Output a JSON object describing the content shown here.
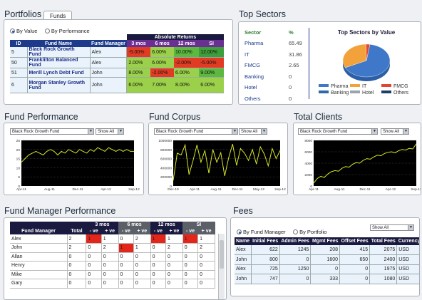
{
  "portfolios": {
    "title": "Portfolios",
    "tab": "Funds",
    "radio_value": "By Value",
    "radio_performance": "By Performance",
    "group_header": "Absolute Returns",
    "headers": [
      "ID",
      "Fund Name",
      "Fund Manager",
      "3 mos",
      "6 mos",
      "12 mos",
      "SI"
    ],
    "rows": [
      {
        "id": "5",
        "name": "Black Rock Growth Fund",
        "manager": "Alex",
        "r3": "-5.00%",
        "r6": "6.00%",
        "r12": "10.00%",
        "si": "12.00%"
      },
      {
        "id": "50",
        "name": "Franklilton Balanced Fund",
        "manager": "Alex",
        "r3": "2.00%",
        "r6": "6.00%",
        "r12": "-2.00%",
        "si": "-5.00%"
      },
      {
        "id": "51",
        "name": "Merill Lynch Debt Fund",
        "manager": "John",
        "r3": "8.00%",
        "r6": "-2.00%",
        "r12": "6.00%",
        "si": "9.00%"
      },
      {
        "id": "6",
        "name": "Morgan Stanley Growth Fund",
        "manager": "John",
        "r3": "6.00%",
        "r6": "7.00%",
        "r12": "8.00%",
        "si": "6.00%"
      }
    ],
    "colors": {
      "r1": [
        "#e23b23",
        "#9bd04a",
        "#5cb83e",
        "#3d9f3a"
      ],
      "r2": [
        "#9bd04a",
        "#9bd04a",
        "#e23b23",
        "#e23b23"
      ],
      "r3": [
        "#9bd04a",
        "#e23b23",
        "#9bd04a",
        "#5cb83e"
      ],
      "r4": [
        "#9bd04a",
        "#9bd04a",
        "#9bd04a",
        "#9bd04a"
      ]
    }
  },
  "sectors": {
    "title": "Top Sectors",
    "col_sector": "Sector",
    "col_pct": "%",
    "rows": [
      {
        "name": "Pharma",
        "value": "65.49"
      },
      {
        "name": "IT",
        "value": "31.86"
      },
      {
        "name": "FMCG",
        "value": "2.65"
      },
      {
        "name": "Banking",
        "value": "0"
      },
      {
        "name": "Hotel",
        "value": "0"
      },
      {
        "name": "Others",
        "value": "0"
      }
    ]
  },
  "fund_performance": {
    "title": "Fund Performance",
    "fund_select": "Black Rock Growth Fund",
    "range_select": "Show All"
  },
  "fund_corpus": {
    "title": "Fund Corpus",
    "fund_select": "Black Rock Growth Fund",
    "range_select": "Show All"
  },
  "total_clients": {
    "title": "Total Clients",
    "fund_select": "Black Rock Growth Fund",
    "range_select": "Show All"
  },
  "fmp": {
    "title": "Fund Manager Performance",
    "groups": [
      "3 mos",
      "6 mos",
      "12 mos",
      "SI"
    ],
    "col_manager": "Fund Manager",
    "col_total": "Total",
    "neg": "- ve",
    "pos": "+ ve",
    "rows": [
      {
        "name": "Alex",
        "vals": [
          "2",
          "1",
          "1",
          "0",
          "2",
          "1",
          "1",
          "1",
          "1"
        ]
      },
      {
        "name": "John",
        "vals": [
          "2",
          "0",
          "2",
          "1",
          "1",
          "0",
          "2",
          "0",
          "2"
        ]
      },
      {
        "name": "Allan",
        "vals": [
          "0",
          "0",
          "0",
          "0",
          "0",
          "0",
          "0",
          "0",
          "0"
        ]
      },
      {
        "name": "Henry",
        "vals": [
          "0",
          "0",
          "0",
          "0",
          "0",
          "0",
          "0",
          "0",
          "0"
        ]
      },
      {
        "name": "Mike",
        "vals": [
          "0",
          "0",
          "0",
          "0",
          "0",
          "0",
          "0",
          "0",
          "0"
        ]
      },
      {
        "name": "Gary",
        "vals": [
          "0",
          "0",
          "0",
          "0",
          "0",
          "0",
          "0",
          "0",
          "0"
        ]
      }
    ]
  },
  "fees": {
    "title": "Fees",
    "radio_manager": "By Fund Manager",
    "radio_portfolio": "By Portfolio",
    "select": "Show All",
    "headers": [
      "Name",
      "Initial Fees",
      "Admin Fees",
      "Mgmt Fees",
      "Offset Fees",
      "Total Fees",
      "Currency"
    ],
    "rows": [
      [
        "Alex",
        "622",
        "1245",
        "208",
        "415",
        "2075",
        "USD"
      ],
      [
        "John",
        "800",
        "0",
        "1600",
        "650",
        "2400",
        "USD"
      ],
      [
        "Alex",
        "725",
        "1250",
        "0",
        "0",
        "1975",
        "USD"
      ],
      [
        "John",
        "747",
        "0",
        "333",
        "0",
        "1080",
        "USD"
      ]
    ]
  },
  "chart_data": [
    {
      "type": "pie",
      "title": "Top Sectors by Value",
      "categories": [
        "Pharma",
        "IT",
        "FMCG",
        "Banking",
        "Hotel",
        "Others"
      ],
      "values": [
        65.49,
        31.86,
        2.65,
        0,
        0,
        0
      ],
      "colors": [
        "#3f78c8",
        "#f3a13a",
        "#e0472d",
        "#2c6aa8",
        "#9aa4ae",
        "#1f3e67"
      ],
      "legend": "bottom"
    },
    {
      "type": "line",
      "x_ticks": [
        "Apr-11",
        "Aug-11",
        "Dec-11",
        "Apr-12",
        "Sep-12"
      ],
      "y_ticks": [
        "0",
        "5",
        "10",
        "15",
        "20",
        "25"
      ],
      "ylim": [
        0,
        25
      ],
      "values": [
        13,
        15,
        17,
        18,
        19,
        18,
        17,
        19,
        20,
        19,
        17,
        19,
        18,
        20,
        19,
        18,
        20,
        19,
        18,
        20,
        19,
        21,
        20,
        19,
        21,
        20,
        19,
        20,
        19,
        20,
        19,
        19
      ]
    },
    {
      "type": "line",
      "x_ticks": [
        "Dec-10",
        "Apr-11",
        "Aug-11",
        "Dec-11",
        "May-12",
        "Sep-12"
      ],
      "y_ticks": [
        "0",
        "200000",
        "400000",
        "600000",
        "800000",
        "1000000"
      ],
      "ylim": [
        0,
        1000000
      ],
      "values": [
        120000,
        720000,
        680000,
        900000,
        250000,
        560000,
        900000,
        520000,
        780000,
        280000,
        800000,
        520000,
        730000,
        220000,
        620000,
        920000,
        450000,
        820000,
        720000,
        560000,
        800000,
        480000,
        860000,
        700000,
        440000,
        820000,
        600000,
        780000
      ]
    },
    {
      "type": "line",
      "x_ticks": [
        "Apr-11",
        "Aug-11",
        "Dec-11",
        "Apr-12",
        "Sep-12"
      ],
      "y_ticks": [
        "0",
        "2000",
        "4000",
        "6000",
        "8000"
      ],
      "ylim": [
        0,
        8000
      ],
      "values": [
        500,
        1300,
        1700,
        1500,
        2100,
        2500,
        2700,
        2600,
        3100,
        3400,
        3300,
        3800,
        4100,
        4000,
        4500,
        4800,
        4700,
        5100,
        5400,
        5300,
        5700,
        5900,
        6000,
        5800,
        6200,
        6400,
        6300,
        6600,
        6500,
        7400
      ]
    }
  ]
}
